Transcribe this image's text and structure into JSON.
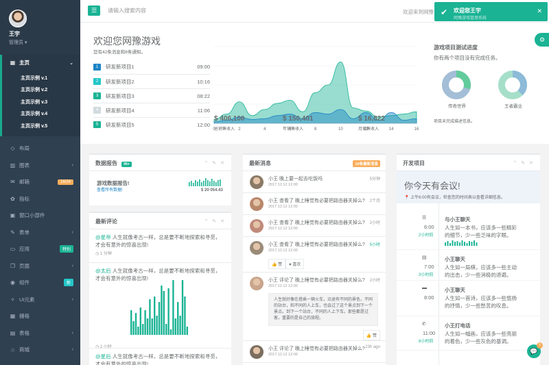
{
  "user": {
    "name": "王宇",
    "role": "管理员 ▾"
  },
  "sidebar": {
    "home": "主页",
    "home_sub": [
      "主页示例 v.1",
      "主页示例 v.2",
      "主页示例 v.3",
      "主页示例 v.4",
      "主页示例 v.5"
    ],
    "items": [
      {
        "icon": "◇",
        "label": "布局",
        "chev": "",
        "badge": ""
      },
      {
        "icon": "▥",
        "label": "图表",
        "chev": "‹",
        "badge": ""
      },
      {
        "icon": "✉",
        "label": "邮箱",
        "chev": "",
        "badge": "16/24"
      },
      {
        "icon": "✿",
        "label": "指标",
        "chev": "",
        "badge": ""
      },
      {
        "icon": "▣",
        "label": "窗口小部件",
        "chev": "",
        "badge": ""
      },
      {
        "icon": "✎",
        "label": "表单",
        "chev": "‹",
        "badge": ""
      },
      {
        "icon": "▭",
        "label": "应用",
        "chev": "",
        "badge": "特别"
      },
      {
        "icon": "❐",
        "label": "页面",
        "chev": "‹",
        "badge": ""
      },
      {
        "icon": "◉",
        "label": "组件",
        "chev": "",
        "badge": "新"
      },
      {
        "icon": "✧",
        "label": "UI元素",
        "chev": "‹",
        "badge": ""
      },
      {
        "icon": "▦",
        "label": "栅格",
        "chev": "",
        "badge": ""
      },
      {
        "icon": "▤",
        "label": "表格",
        "chev": "‹",
        "badge": ""
      },
      {
        "icon": "⌂",
        "label": "商城",
        "chev": "‹",
        "badge": ""
      }
    ]
  },
  "topbar": {
    "search_placeholder": "请输入搜索内容",
    "welcome": "欢迎来到网豫"
  },
  "toast": {
    "title": "欢迎您王宇",
    "sub": "网豫游戏管理系统"
  },
  "overview": {
    "title": "欢迎您网豫游戏",
    "subtitle": "您有42条消息和8条通知。",
    "projects": [
      {
        "num": "1",
        "name": "研发新项目1",
        "time": "09:00",
        "color": "#1c84c6"
      },
      {
        "num": "2",
        "name": "研发新项目2",
        "time": "10:16",
        "color": "#23c6c8"
      },
      {
        "num": "3",
        "name": "研发新项目3",
        "time": "08:22",
        "color": "#1ab394"
      },
      {
        "num": "4",
        "name": "研发新项目4",
        "time": "11:06",
        "color": "#d1dade"
      },
      {
        "num": "5",
        "name": "研发新项目5",
        "time": "12:00",
        "color": "#1ab394"
      }
    ],
    "stats": [
      {
        "value": "$ 406,100",
        "label": "总销售收入"
      },
      {
        "value": "$ 150,401",
        "label": "年销售收入"
      },
      {
        "value": "$ 16,822",
        "label": "月销售收入"
      }
    ],
    "progress_title": "游戏项目测试进度",
    "progress_sub": "你有两个项目没有完成任务。",
    "donut1_label": "传奇世界",
    "donut2_label": "王者霸业",
    "progress_note": "项目未完成描述信息。"
  },
  "chart_data": {
    "type": "area",
    "x": [
      0,
      1,
      2,
      3,
      4,
      5,
      6,
      7,
      8,
      9,
      10,
      11,
      12,
      13,
      14,
      15,
      16
    ],
    "xticks": [
      0,
      2,
      4,
      6,
      8,
      10,
      12,
      14,
      16
    ],
    "yticks": [],
    "ylim": [
      0,
      100
    ],
    "series": [
      {
        "color": "#1ab394",
        "values": [
          5,
          12,
          28,
          10,
          18,
          26,
          30,
          15,
          40,
          50,
          80,
          20,
          16,
          8,
          10,
          12,
          15
        ]
      },
      {
        "color": "#1c84c6",
        "values": [
          2,
          4,
          8,
          5,
          6,
          10,
          12,
          6,
          14,
          12,
          18,
          6,
          14,
          4,
          14,
          4,
          6
        ]
      }
    ]
  },
  "reports": {
    "title": "数据报告",
    "badge": "IN+",
    "head": "游戏数据报告!",
    "link": "查看所有数据!",
    "amount": "$ 20 054.43",
    "spark": [
      6,
      8,
      5,
      9,
      7,
      10,
      6,
      8,
      12,
      9,
      7,
      11,
      8,
      6,
      9,
      10
    ]
  },
  "comments": {
    "title": "最新评论",
    "items": [
      {
        "name": "@星帝",
        "text": " 人生就像考古一样，总是要不断地探索和寻觅，才会有意外的惊喜出现!",
        "ago": "◷ 1 分钟"
      },
      {
        "name": "@太后",
        "text": " 人生就像考古一样，总是要不断地探索和寻觅，才会有意外的惊喜出现!",
        "ago": "◷ 2 小时"
      },
      {
        "name": "@星后",
        "text": " 人生就像考古一样，总是要不断地探索和寻觅，才会有意外的惊喜出现!",
        "ago": ""
      }
    ],
    "bars": [
      9,
      5,
      8,
      3,
      10,
      4,
      9,
      6,
      13,
      6,
      14,
      7,
      12,
      18,
      16,
      4,
      17,
      2,
      20,
      6,
      12,
      7,
      20,
      14,
      3
    ]
  },
  "messages": {
    "title": "最新消息",
    "badge": "10条最新消息",
    "items": [
      {
        "title": "小王 晚上要一起去吃饭吗",
        "date": "2017.12.12 12:00",
        "right": "5分钟"
      },
      {
        "title": "小王 查看了 晚上睡觉有必要把路由器关掉么?",
        "date": "2017.12.12 12:00",
        "right": "2个月"
      },
      {
        "title": "小王 查看了 晚上睡觉有必要把路由器关掉么?",
        "date": "2017.12.12 12:00",
        "right": "2小时"
      },
      {
        "title": "小王 查看了 晚上睡觉有必要把路由器关掉么?",
        "date": "2017.12.12 12:00",
        "right": "5小时"
      },
      {
        "title": "小王 评论了 晚上睡觉有必要把路由器关掉么?",
        "date": "2017.12.12 12:00",
        "right": "2小时"
      },
      {
        "title": "小王 评论了 晚上睡觉有必要把路由器关掉么?",
        "date": "2017.12.12 12:00",
        "right": "23h ago"
      }
    ],
    "like": "👍 赞",
    "love": "♥ 喜欢",
    "like2": "👍 赞",
    "quote": "人生就好像在搭乘一辆火车，沿途有不同的景色，不同的站台，和不同的人上车，也会过了这个景点到下一个景点。到下一个站台，不同的人上下车。那些都是过客，重要的是自己的旅程。"
  },
  "dev": {
    "title": "开发项目",
    "meeting_h": "你今天有会议!",
    "meeting_sub": "📍 上午6:00有会议，检查您的时间表以查看详细信息。",
    "timeline": [
      {
        "icon": "☰",
        "time": "6:00",
        "ago": "2小时前",
        "title": "与小王聊天",
        "text": "人生如一本书，应该多一些精彩的细节，少一些乏味的字眼。"
      },
      {
        "icon": "▤",
        "time": "7:00",
        "ago": "3小时前",
        "title": "小王聊天",
        "text": "人生如一局棋，应该多一些主动的出击，少一些消极的退避。"
      },
      {
        "icon": "▬",
        "time": "8:00",
        "ago": "",
        "title": "小王聊天",
        "text": "人生如一首诗，应该多一些悠扬的抒情，少一些愁苦的叹息。"
      },
      {
        "icon": "✆",
        "time": "11:00",
        "ago": "8小时前",
        "title": "小王打电话",
        "text": "人生如一幅画，应该多一些亮丽的着色，少一些灰色的基调。"
      }
    ]
  }
}
